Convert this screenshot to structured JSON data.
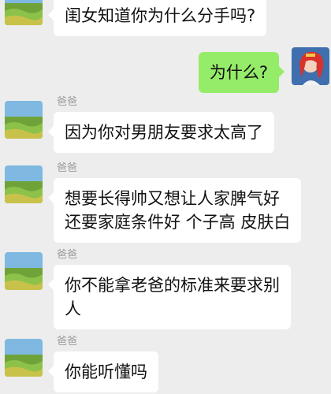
{
  "chat": {
    "messages": [
      {
        "direction": "incoming",
        "sender": "",
        "text": "闺女知道你为什么分手吗?"
      },
      {
        "direction": "outgoing",
        "sender": "",
        "text": "为什么?"
      },
      {
        "direction": "incoming",
        "sender": "爸爸",
        "text": "因为你对男朋友要求太高了"
      },
      {
        "direction": "incoming",
        "sender": "爸爸",
        "text": "想要长得帅又想让人家脾气好\n还要家庭条件好 个子高 皮肤白"
      },
      {
        "direction": "incoming",
        "sender": "爸爸",
        "text": "你不能拿老爸的标准来要求别\n人"
      },
      {
        "direction": "incoming",
        "sender": "爸爸",
        "text": "你能听懂吗"
      }
    ]
  },
  "colors": {
    "background": "#ededed",
    "incoming_bubble": "#ffffff",
    "outgoing_bubble": "#95ec69",
    "sender_name": "#9a9a9a"
  },
  "icons": {
    "dad_avatar": "landscape-avatar-icon",
    "user_avatar": "princess-avatar-icon"
  }
}
